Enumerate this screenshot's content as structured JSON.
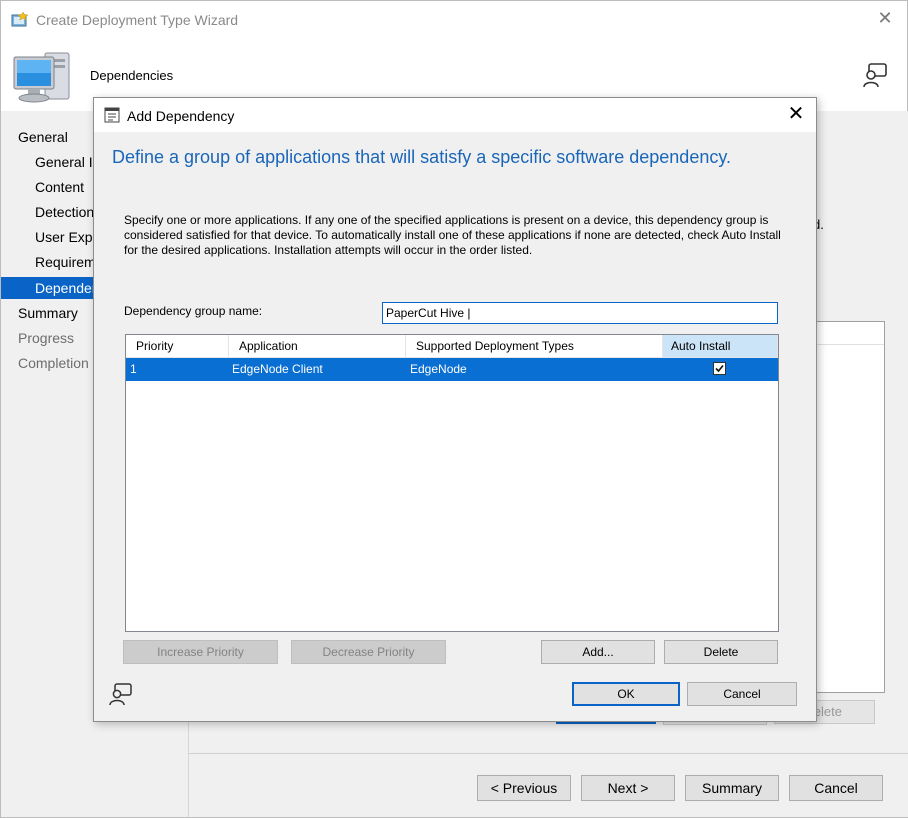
{
  "wizard": {
    "title": "Create Deployment Type Wizard",
    "step_title": "Dependencies",
    "nav": {
      "general": "General",
      "general_info": "General In",
      "content": "Content",
      "detection": "Detection",
      "user_experience": "User Expe",
      "requirements": "Requirem",
      "dependencies": "Depender",
      "summary": "Summary",
      "progress": "Progress",
      "completion": "Completion"
    },
    "bg_text_fragment": "d.",
    "bg_delete_fragment": "elete",
    "footer": {
      "previous": "< Previous",
      "next": "Next >",
      "summary": "Summary",
      "cancel": "Cancel"
    }
  },
  "dialog": {
    "title": "Add Dependency",
    "heading": "Define a group of applications that will satisfy a specific software dependency.",
    "description": "Specify one or more applications. If any one of the specified applications is present on a device, this dependency group is considered satisfied for that device. To automatically install one of these applications if none are detected, check Auto Install for the desired applications. Installation attempts will occur in the order listed.",
    "group_name_label": "Dependency group name:",
    "group_name_value": "PaperCut Hive |",
    "columns": [
      "Priority",
      "Application",
      "Supported Deployment Types",
      "Auto Install"
    ],
    "rows": [
      {
        "priority": "1",
        "application": "EdgeNode Client",
        "deployment_types": "EdgeNode",
        "auto_install": true
      }
    ],
    "buttons": {
      "increase_priority": "Increase Priority",
      "decrease_priority": "Decrease Priority",
      "add": "Add...",
      "delete": "Delete",
      "ok": "OK",
      "cancel": "Cancel"
    }
  },
  "colors": {
    "accent": "#0a64c8",
    "heading_blue": "#1a66b8",
    "selected_row": "#0a6fd2",
    "dialog_bg": "#f0f0f0"
  }
}
